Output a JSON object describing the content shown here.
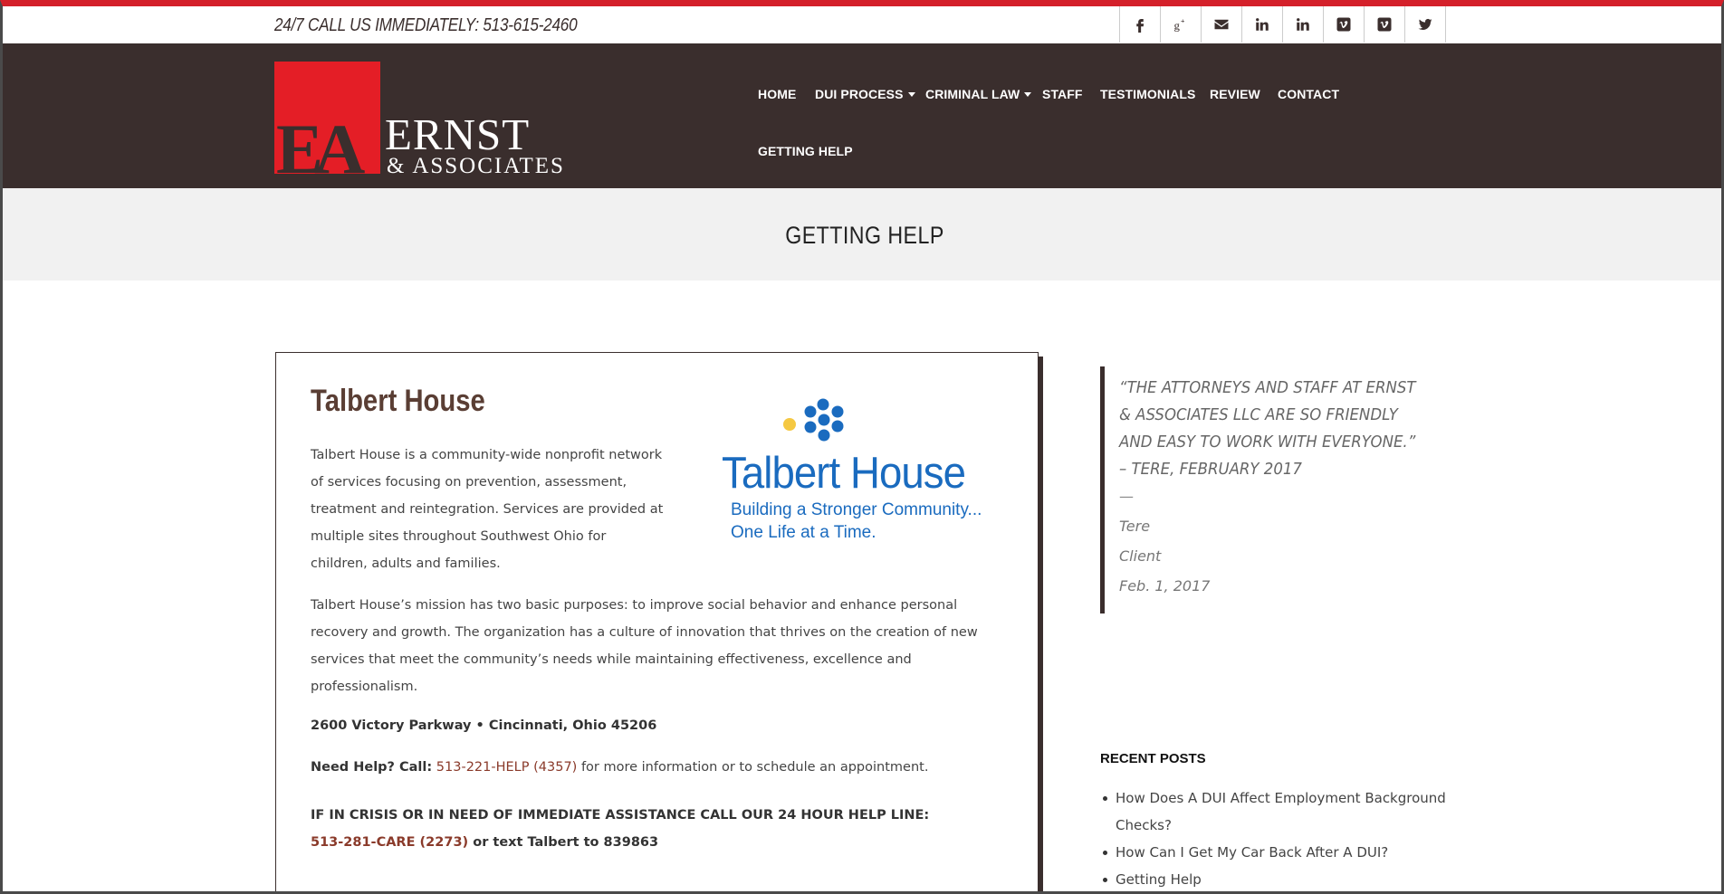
{
  "topbar": {
    "call_text": "24/7 CALL US IMMEDIATELY: 513-615-2460",
    "social": [
      "facebook-icon",
      "google-plus-icon",
      "email-icon",
      "linkedin-icon",
      "linkedin-icon",
      "vimeo-icon",
      "vimeo-icon",
      "twitter-icon"
    ]
  },
  "logo": {
    "initials": "EA",
    "name": "ERNST",
    "sub": "& ASSOCIATES"
  },
  "nav": {
    "home": "HOME",
    "dui_process": "DUI PROCESS",
    "criminal_law": "CRIMINAL LAW",
    "staff": "STAFF",
    "testimonials": "TESTIMONIALS",
    "review": "REVIEW",
    "contact": "CONTACT",
    "getting_help": "GETTING HELP"
  },
  "page_title": "GETTING HELP",
  "card": {
    "title": "Talbert House",
    "p1": "Talbert House is a community-wide nonprofit network of services focusing on prevention, assessment, treatment and reintegration. Services are provided at multiple sites throughout Southwest Ohio for children, adults and families.",
    "p2": "Talbert House’s mission has two basic purposes: to improve social behavior and enhance personal recovery and growth. The organization has a culture of innovation that thrives on the creation of new services that meet the community’s needs while maintaining effectiveness, excellence and professionalism.",
    "address": "2600 Victory Parkway • Cincinnati, Ohio 45206",
    "help_prefix": "Need Help? Call:",
    "help_number": "513-221-HELP (4357)",
    "help_suffix": "for more information or to schedule an appointment.",
    "crisis_line1": "IF IN CRISIS OR IN NEED OF IMMEDIATE ASSISTANCE CALL OUR 24 HOUR HELP LINE:",
    "crisis_number": "513-281-CARE (2273)",
    "crisis_suffix": "or text Talbert to 839863",
    "logo": {
      "name": "Talbert House",
      "tagline1": "Building a Stronger Community...",
      "tagline2": "One Life at a Time."
    }
  },
  "testimonial": {
    "text": "“THE ATTORNEYS AND STAFF AT ERNST & ASSOCIATES LLC ARE SO FRIENDLY AND EASY TO WORK WITH EVERYONE.” – TERE,  FEBRUARY 2017",
    "dash": "—",
    "name": "Tere",
    "role": "Client",
    "date": "Feb. 1, 2017"
  },
  "recent_posts": {
    "title": "RECENT POSTS",
    "items": [
      "How Does A DUI Affect Employment Background Checks?",
      "How Can I Get My Car Back After A DUI?",
      "Getting Help"
    ]
  },
  "colors": {
    "brand_dark": "#3a2e2d",
    "brand_red": "#e41e26",
    "talbert_blue": "#1a6bbf"
  }
}
